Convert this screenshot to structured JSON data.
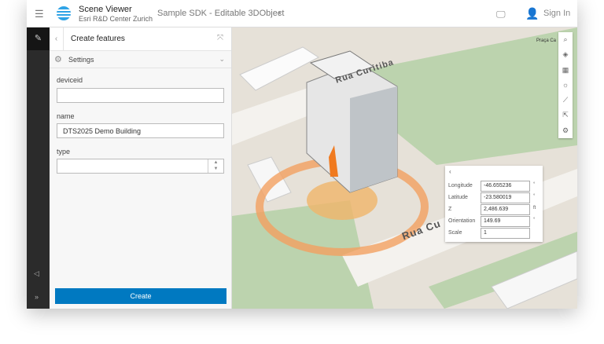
{
  "header": {
    "app_name": "Scene Viewer",
    "org": "Esri R&D Center Zurich",
    "scene_title": "Sample SDK - Editable 3DObject",
    "sign_in": "Sign In"
  },
  "panel": {
    "title": "Create features",
    "settings_label": "Settings",
    "fields": [
      {
        "label": "deviceid",
        "value": ""
      },
      {
        "label": "name",
        "value": "DTS2025 Demo Building"
      },
      {
        "label": "type",
        "value": ""
      }
    ],
    "create_label": "Create"
  },
  "map": {
    "streets": [
      "Rua Curitiba",
      "Rua Cu",
      "Praça Ca"
    ]
  },
  "popup": {
    "rows": [
      {
        "label": "Longitude",
        "value": "-46.655236",
        "unit": "°"
      },
      {
        "label": "Latitude",
        "value": "-23.580019",
        "unit": "°"
      },
      {
        "label": "Z",
        "value": "2,486.639",
        "unit": "ft"
      },
      {
        "label": "Orientation",
        "value": "149.69",
        "unit": "°"
      },
      {
        "label": "Scale",
        "value": "1",
        "unit": ""
      }
    ]
  },
  "colors": {
    "accent": "#0079c1",
    "handle": "#f07a1f"
  }
}
